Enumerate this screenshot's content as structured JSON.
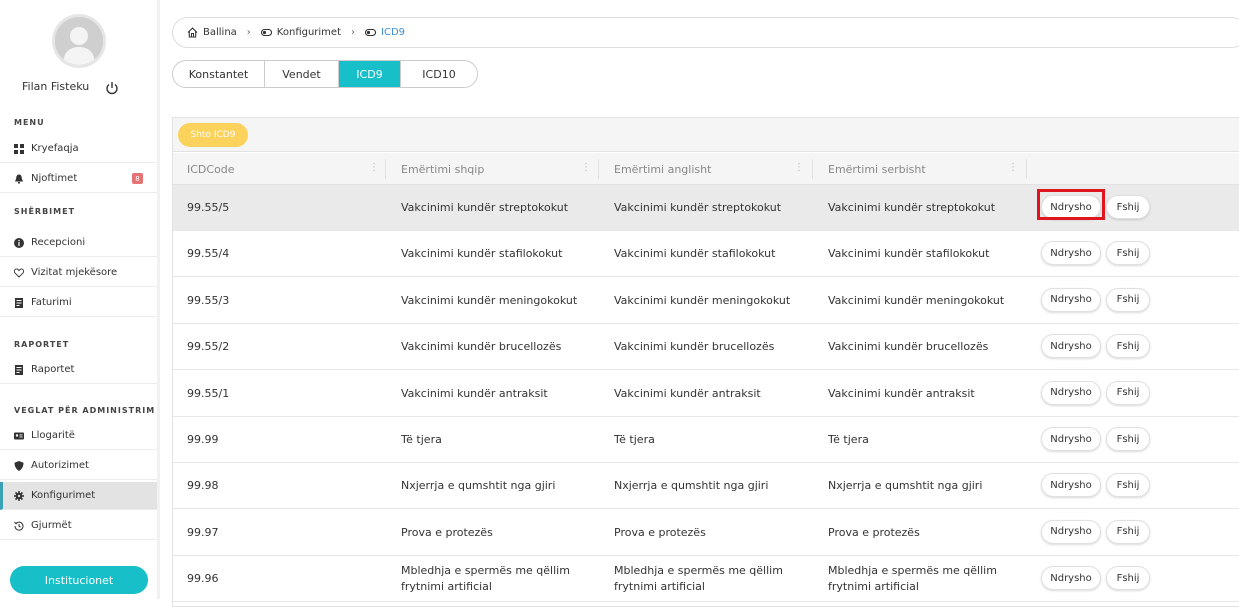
{
  "user": {
    "name": "Filan Fisteku"
  },
  "sidebar": {
    "sections": [
      {
        "title": "MENU"
      },
      {
        "title": "SHËRBIMET"
      },
      {
        "title": "RAPORTET"
      },
      {
        "title": "VEGLAT PËR ADMINISTRIM"
      }
    ],
    "items": [
      {
        "label": "Kryefaqja",
        "icon": "dashboard-icon"
      },
      {
        "label": "Njoftimet",
        "icon": "bell-icon",
        "badge": "8"
      },
      {
        "label": "Recepcioni",
        "icon": "info-icon"
      },
      {
        "label": "Vizitat mjekësore",
        "icon": "heartbeat-icon"
      },
      {
        "label": "Faturimi",
        "icon": "invoice-icon"
      },
      {
        "label": "Raportet",
        "icon": "report-icon"
      },
      {
        "label": "Llogaritë",
        "icon": "id-card-icon"
      },
      {
        "label": "Autorizimet",
        "icon": "shield-icon"
      },
      {
        "label": "Konfigurimet",
        "icon": "gear-icon",
        "active": true
      },
      {
        "label": "Gjurmët",
        "icon": "history-icon"
      }
    ],
    "institutions_button": "Institucionet"
  },
  "breadcrumb": [
    {
      "label": "Ballina",
      "icon": "home-icon"
    },
    {
      "label": "Konfigurimet",
      "icon": "toggle-icon"
    },
    {
      "label": "ICD9",
      "icon": "toggle-icon",
      "active": true
    }
  ],
  "tabs": [
    {
      "label": "Konstantet"
    },
    {
      "label": "Vendet"
    },
    {
      "label": "ICD9",
      "active": true
    },
    {
      "label": "ICD10"
    }
  ],
  "toolbar": {
    "add_label": "Shto ICD9"
  },
  "table": {
    "columns": [
      "ICDCode",
      "Emërtimi shqip",
      "Emërtimi anglisht",
      "Emërtimi serbisht"
    ],
    "edit_label": "Ndrysho",
    "delete_label": "Fshij",
    "rows": [
      {
        "code": "99.55/5",
        "sq": "Vakcinimi kundër streptokokut",
        "en": "Vakcinimi kundër streptokokut",
        "sr": "Vakcinimi kundër streptokokut",
        "selected": true
      },
      {
        "code": "99.55/4",
        "sq": "Vakcinimi kundër stafilokokut",
        "en": "Vakcinimi kundër stafilokokut",
        "sr": "Vakcinimi kundër stafilokokut"
      },
      {
        "code": "99.55/3",
        "sq": "Vakcinimi kundër meningokokut",
        "en": "Vakcinimi kundër meningokokut",
        "sr": "Vakcinimi kundër meningokokut"
      },
      {
        "code": "99.55/2",
        "sq": "Vakcinimi kundër brucellozës",
        "en": "Vakcinimi kundër brucellozës",
        "sr": "Vakcinimi kundër brucellozës"
      },
      {
        "code": "99.55/1",
        "sq": "Vakcinimi kundër antraksit",
        "en": "Vakcinimi kundër antraksit",
        "sr": "Vakcinimi kundër antraksit"
      },
      {
        "code": "99.99",
        "sq": "Të tjera",
        "en": "Të tjera",
        "sr": "Të tjera"
      },
      {
        "code": "99.98",
        "sq": "Nxjerrja e qumshtit nga gjiri",
        "en": "Nxjerrja e qumshtit nga gjiri",
        "sr": "Nxjerrja e qumshtit nga gjiri"
      },
      {
        "code": "99.97",
        "sq": "Prova e protezës",
        "en": "Prova e protezës",
        "sr": "Prova e protezës"
      },
      {
        "code": "99.96",
        "sq": "Mbledhja e spermës me qëllim frytnimi artificial",
        "en": "Mbledhja e spermës me qëllim frytnimi artificial",
        "sr": "Mbledhja e spermës me qëllim frytnimi artificial"
      }
    ]
  },
  "colors": {
    "accent": "#17bfc8",
    "add_button": "#fbd25b",
    "badge": "#e57373",
    "highlight": "#e0161f",
    "link": "#3f8fd2"
  }
}
